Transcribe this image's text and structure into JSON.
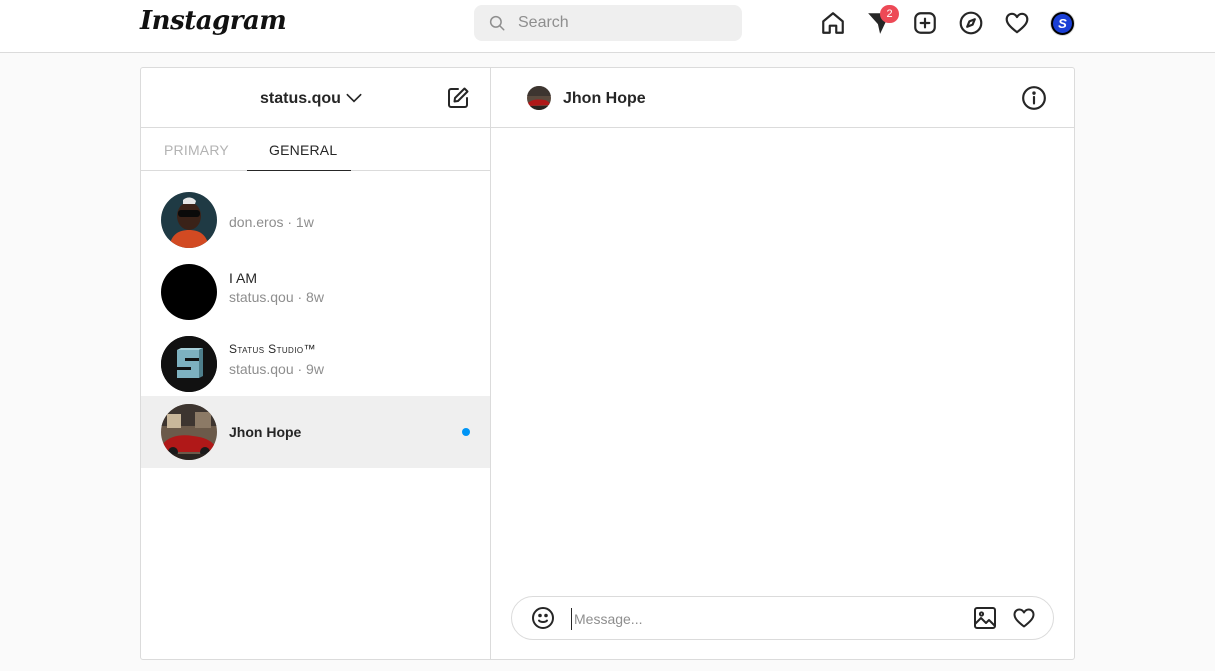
{
  "topbar": {
    "logo": "Instagram",
    "search_placeholder": "Search",
    "direct_badge": "2",
    "profile_initial": "S",
    "icons": [
      "home-icon",
      "direct-icon",
      "new-post-icon",
      "explore-icon",
      "activity-heart-icon",
      "profile-avatar"
    ]
  },
  "inbox": {
    "account": "status.qou",
    "tabs": [
      {
        "label": "PRIMARY",
        "active": false
      },
      {
        "label": "GENERAL",
        "active": true
      }
    ],
    "threads": [
      {
        "name": "",
        "meta": "don.eros · 1w",
        "unread": false,
        "active": false
      },
      {
        "name": "I AM",
        "meta": "status.qou · 8w",
        "unread": false,
        "active": false
      },
      {
        "name": "Status Studio™",
        "meta": "status.qou · 9w",
        "unread": false,
        "active": false
      },
      {
        "name": "Jhon Hope",
        "meta": "",
        "unread": true,
        "active": true
      }
    ]
  },
  "chat": {
    "name": "Jhon Hope",
    "message_placeholder": "Message..."
  },
  "colors": {
    "accent_blue": "#0095f6",
    "badge_red": "#ed4956",
    "border": "#dbdbdb",
    "background": "#fafafa"
  }
}
